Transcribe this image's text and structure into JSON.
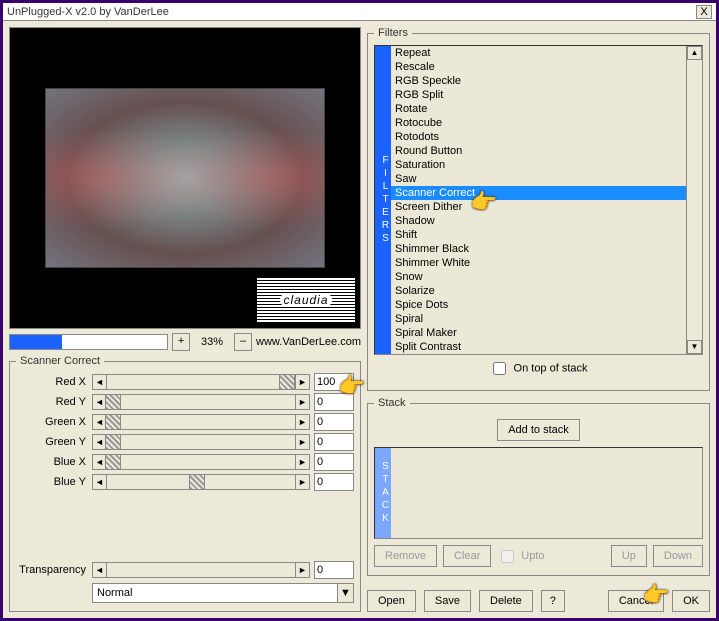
{
  "window": {
    "title": "UnPlugged-X v2.0 by VanDerLee",
    "close": "X"
  },
  "zoom": {
    "plus": "+",
    "minus": "–",
    "pct": "33%",
    "url": "www.VanDerLee.com",
    "progress_pct": 33
  },
  "claudia": "claudia",
  "filter_group": {
    "legend": "Scanner Correct",
    "params": [
      {
        "label": "Red X",
        "value": "100",
        "thumb_pct": 96
      },
      {
        "label": "Red Y",
        "value": "0",
        "thumb_pct": 3
      },
      {
        "label": "Green X",
        "value": "0",
        "thumb_pct": 3
      },
      {
        "label": "Green Y",
        "value": "0",
        "thumb_pct": 3
      },
      {
        "label": "Blue X",
        "value": "0",
        "thumb_pct": 3
      },
      {
        "label": "Blue Y",
        "value": "0",
        "thumb_pct": 48
      }
    ],
    "transparency_label": "Transparency",
    "transparency_value": "0",
    "mode": "Normal"
  },
  "filters": {
    "legend": "Filters",
    "vlabel": "FILTERS",
    "items": [
      "Repeat",
      "Rescale",
      "RGB Speckle",
      "RGB Split",
      "Rotate",
      "Rotocube",
      "Rotodots",
      "Round Button",
      "Saturation",
      "Saw",
      "Scanner Correct",
      "Screen Dither",
      "Shadow",
      "Shift",
      "Shimmer Black",
      "Shimmer White",
      "Snow",
      "Solarize",
      "Spice Dots",
      "Spiral",
      "Spiral Maker",
      "Split Contrast"
    ],
    "selected_index": 10,
    "ontop": "On top of stack"
  },
  "stack": {
    "legend": "Stack",
    "vlabel": "STACK",
    "add": "Add to stack",
    "remove": "Remove",
    "clear": "Clear",
    "upto": "Upto",
    "up": "Up",
    "down": "Down"
  },
  "buttons": {
    "open": "Open",
    "save": "Save",
    "delete": "Delete",
    "help": "?",
    "cancel": "Cancel",
    "ok": "OK"
  },
  "glyph": {
    "left": "◄",
    "right": "►",
    "up": "▲",
    "down": "▼",
    "dd": "▼"
  }
}
